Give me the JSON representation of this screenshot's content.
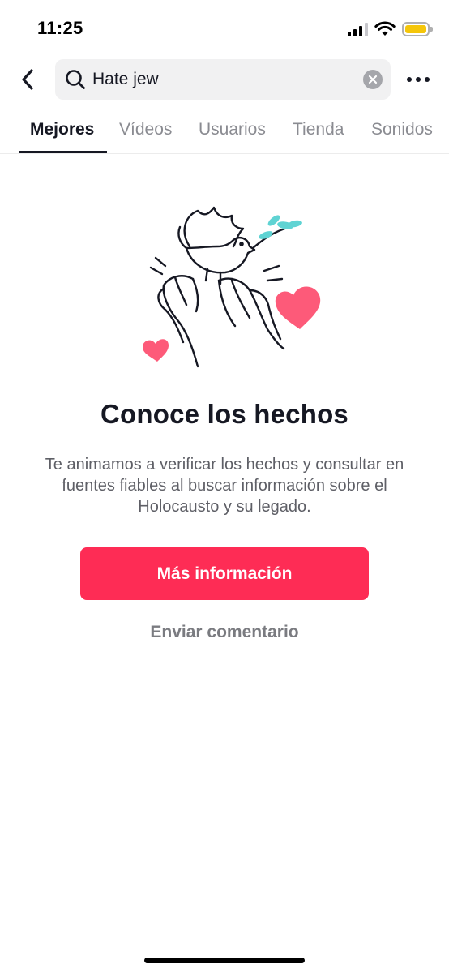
{
  "status_bar": {
    "time": "11:25",
    "icons": [
      "signal-icon",
      "wifi-icon",
      "battery-icon"
    ],
    "battery_color": "#f5c60a"
  },
  "header": {
    "back_icon": "chevron-left-icon",
    "search": {
      "value": "Hate jew",
      "placeholder": "Buscar",
      "icon": "search-icon",
      "clear_icon": "close-icon"
    },
    "more_icon": "more-icon"
  },
  "tabs": [
    {
      "label": "Mejores",
      "active": true
    },
    {
      "label": "Vídeos",
      "active": false
    },
    {
      "label": "Usuarios",
      "active": false
    },
    {
      "label": "Tienda",
      "active": false
    },
    {
      "label": "Sonidos",
      "active": false
    }
  ],
  "content": {
    "illustration": "dove-hands-hearts-illustration",
    "title": "Conoce los hechos",
    "description": "Te animamos a verificar los hechos y consultar en fuentes fiables al buscar información sobre el Holocausto y su legado.",
    "primary_button": "Más información",
    "secondary_link": "Enviar comentario"
  },
  "colors": {
    "accent": "#fe2c55",
    "heart": "#fd5a79",
    "leaf": "#5fd3d3",
    "text_primary": "#161823",
    "text_secondary": "#5e5f66"
  }
}
